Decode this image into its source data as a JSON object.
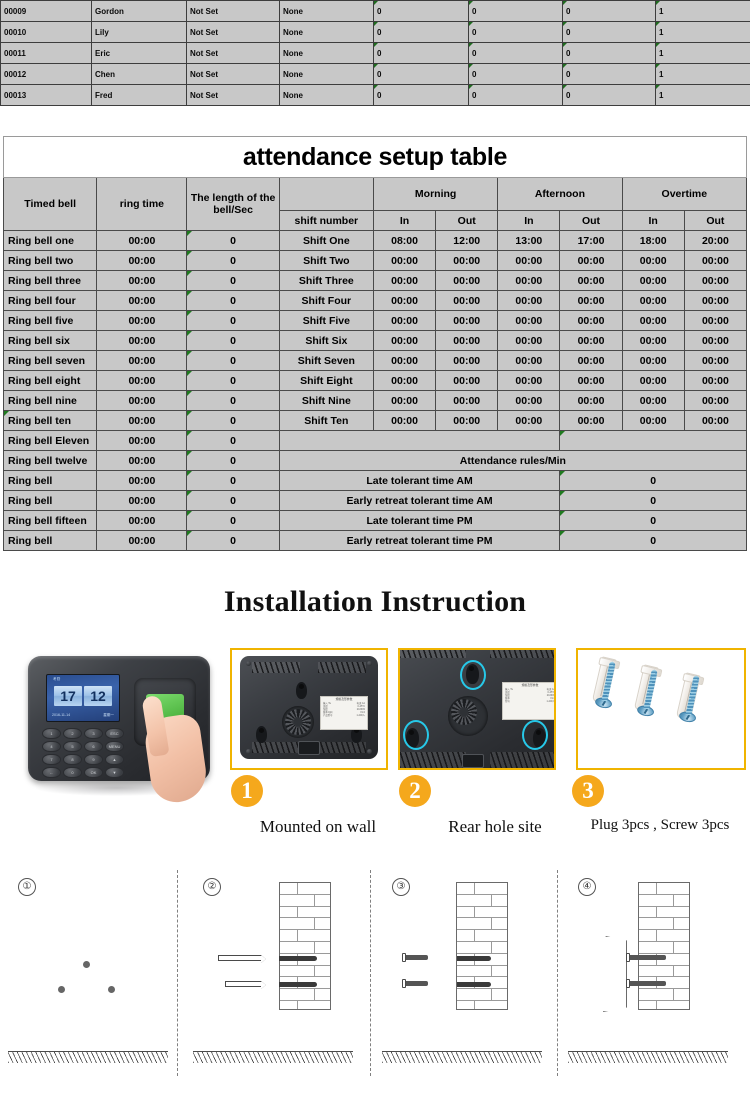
{
  "employee_table": {
    "rows": [
      {
        "id": "00009",
        "name": "Gordon",
        "privilege": "Not Set",
        "password": "None",
        "c5": "0",
        "c6": "0",
        "c7": "0",
        "c8": "1"
      },
      {
        "id": "00010",
        "name": "Lily",
        "privilege": "Not Set",
        "password": "None",
        "c5": "0",
        "c6": "0",
        "c7": "0",
        "c8": "1"
      },
      {
        "id": "00011",
        "name": "Eric",
        "privilege": "Not Set",
        "password": "None",
        "c5": "0",
        "c6": "0",
        "c7": "0",
        "c8": "1"
      },
      {
        "id": "00012",
        "name": "Chen",
        "privilege": "Not Set",
        "password": "None",
        "c5": "0",
        "c6": "0",
        "c7": "0",
        "c8": "1"
      },
      {
        "id": "00013",
        "name": "Fred",
        "privilege": "Not Set",
        "password": "None",
        "c5": "0",
        "c6": "0",
        "c7": "0",
        "c8": "1"
      }
    ]
  },
  "setup_table": {
    "title": "attendance setup table",
    "headers": {
      "timed_bell": "Timed bell",
      "ring_time": "ring time",
      "bell_length": "The length of the bell/Sec",
      "blank": "",
      "morning": "Morning",
      "afternoon": "Afternoon",
      "overtime": "Overtime"
    },
    "sub_headers": {
      "shift_number": "shift number",
      "morning_in": "In",
      "morning_out": "Out",
      "afternoon_in": "In",
      "afternoon_out": "Out",
      "overtime_in": "In",
      "overtime_out": "Out"
    },
    "bells": [
      {
        "label": "Ring bell one",
        "time": "00:00",
        "sec": "0"
      },
      {
        "label": "Ring bell two",
        "time": "00:00",
        "sec": "0"
      },
      {
        "label": "Ring bell three",
        "time": "00:00",
        "sec": "0"
      },
      {
        "label": "Ring bell four",
        "time": "00:00",
        "sec": "0"
      },
      {
        "label": "Ring bell five",
        "time": "00:00",
        "sec": "0"
      },
      {
        "label": "Ring bell six",
        "time": "00:00",
        "sec": "0"
      },
      {
        "label": "Ring bell seven",
        "time": "00:00",
        "sec": "0"
      },
      {
        "label": "Ring bell eight",
        "time": "00:00",
        "sec": "0"
      },
      {
        "label": "Ring bell nine",
        "time": "00:00",
        "sec": "0"
      },
      {
        "label": "Ring bell ten",
        "time": "00:00",
        "sec": "0"
      },
      {
        "label": "Ring bell Eleven",
        "time": "00:00",
        "sec": "0"
      },
      {
        "label": "Ring bell twelve",
        "time": "00:00",
        "sec": "0"
      },
      {
        "label": "Ring bell",
        "time": "00:00",
        "sec": "0"
      },
      {
        "label": "Ring bell",
        "time": "00:00",
        "sec": "0"
      },
      {
        "label": "Ring bell fifteen",
        "time": "00:00",
        "sec": "0"
      },
      {
        "label": "Ring bell",
        "time": "00:00",
        "sec": "0"
      }
    ],
    "shifts": [
      {
        "name": "Shift One",
        "am_in": "08:00",
        "am_out": "12:00",
        "pm_in": "13:00",
        "pm_out": "17:00",
        "ot_in": "18:00",
        "ot_out": "20:00"
      },
      {
        "name": "Shift Two",
        "am_in": "00:00",
        "am_out": "00:00",
        "pm_in": "00:00",
        "pm_out": "00:00",
        "ot_in": "00:00",
        "ot_out": "00:00"
      },
      {
        "name": "Shift Three",
        "am_in": "00:00",
        "am_out": "00:00",
        "pm_in": "00:00",
        "pm_out": "00:00",
        "ot_in": "00:00",
        "ot_out": "00:00"
      },
      {
        "name": "Shift Four",
        "am_in": "00:00",
        "am_out": "00:00",
        "pm_in": "00:00",
        "pm_out": "00:00",
        "ot_in": "00:00",
        "ot_out": "00:00"
      },
      {
        "name": "Shift Five",
        "am_in": "00:00",
        "am_out": "00:00",
        "pm_in": "00:00",
        "pm_out": "00:00",
        "ot_in": "00:00",
        "ot_out": "00:00"
      },
      {
        "name": "Shift Six",
        "am_in": "00:00",
        "am_out": "00:00",
        "pm_in": "00:00",
        "pm_out": "00:00",
        "ot_in": "00:00",
        "ot_out": "00:00"
      },
      {
        "name": "Shift Seven",
        "am_in": "00:00",
        "am_out": "00:00",
        "pm_in": "00:00",
        "pm_out": "00:00",
        "ot_in": "00:00",
        "ot_out": "00:00"
      },
      {
        "name": "Shift Eight",
        "am_in": "00:00",
        "am_out": "00:00",
        "pm_in": "00:00",
        "pm_out": "00:00",
        "ot_in": "00:00",
        "ot_out": "00:00"
      },
      {
        "name": "Shift Nine",
        "am_in": "00:00",
        "am_out": "00:00",
        "pm_in": "00:00",
        "pm_out": "00:00",
        "ot_in": "00:00",
        "ot_out": "00:00"
      },
      {
        "name": "Shift Ten",
        "am_in": "00:00",
        "am_out": "00:00",
        "pm_in": "00:00",
        "pm_out": "00:00",
        "ot_in": "00:00",
        "ot_out": "00:00"
      }
    ],
    "rules_header": "Attendance rules/Min",
    "rules": [
      {
        "label": "Late tolerant time AM",
        "value": "0"
      },
      {
        "label": "Early retreat tolerant time AM",
        "value": "0"
      },
      {
        "label": "Late tolerant time PM",
        "value": "0"
      },
      {
        "label": "Early retreat tolerant time PM",
        "value": "0"
      }
    ]
  },
  "installation": {
    "title": "Installation Instruction",
    "panels": [
      {
        "badge": "1",
        "caption": "Mounted on wall"
      },
      {
        "badge": "2",
        "caption": "Rear hole site"
      },
      {
        "badge": "3",
        "caption": "Plug 3pcs , Screw 3pcs"
      }
    ],
    "device_screen": {
      "hour": "17",
      "minute": "12",
      "top_text": "考勤",
      "date": "2016-11-14",
      "weekday": "星期一"
    },
    "keypad": [
      "1",
      "2",
      "3",
      "ESC",
      "4",
      "5",
      "6",
      "MENU",
      "7",
      "8",
      "9",
      "▲",
      "←",
      "0",
      "OK",
      "▼"
    ],
    "sticker": {
      "title": "规格及形参数",
      "lines": [
        [
          "输入  5v",
          "电流  1A"
        ],
        [
          "使用环境温度",
          "0°C - 45°C"
        ],
        [
          "使用环境湿度",
          "20% - 80%"
        ],
        [
          "版本号码",
          "V1.0 下载"
        ],
        [
          "产品型号",
          "1.5v 指纹",
          "1 - 200人"
        ]
      ]
    },
    "steps": [
      {
        "num": "①"
      },
      {
        "num": "②"
      },
      {
        "num": "③"
      },
      {
        "num": "④"
      }
    ]
  },
  "colors": {
    "table_cell_bg": "#c8c8c8",
    "table_border": "#4a4a4a",
    "panel_border": "#f0b400",
    "badge_bg": "#f5a81c",
    "highlight_circle": "#27c8e8",
    "fingerprint_pad": "#3fa832"
  }
}
